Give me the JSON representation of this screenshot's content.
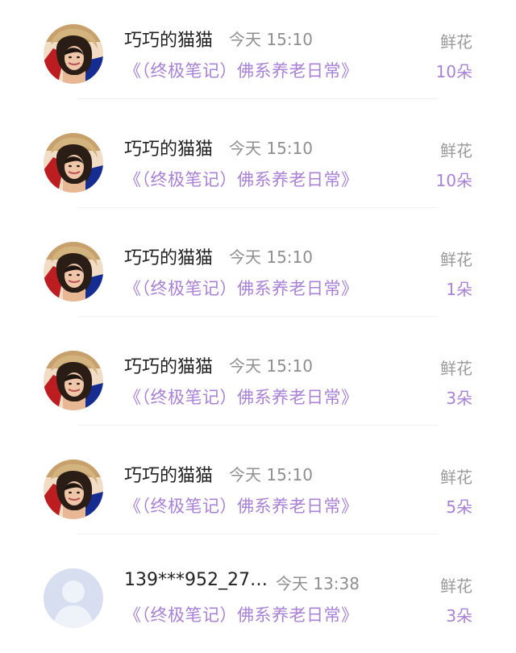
{
  "records": [
    {
      "user": "巧巧的猫猫",
      "time": "今天 15:10",
      "book": "《（终极笔记）佛系养老日常》",
      "gift_label": "鲜花",
      "count": "10朵",
      "avatar": "photo-avatar"
    },
    {
      "user": "巧巧的猫猫",
      "time": "今天 15:10",
      "book": "《（终极笔记）佛系养老日常》",
      "gift_label": "鲜花",
      "count": "10朵",
      "avatar": "photo-avatar"
    },
    {
      "user": "巧巧的猫猫",
      "time": "今天 15:10",
      "book": "《（终极笔记）佛系养老日常》",
      "gift_label": "鲜花",
      "count": "1朵",
      "avatar": "photo-avatar"
    },
    {
      "user": "巧巧的猫猫",
      "time": "今天 15:10",
      "book": "《（终极笔记）佛系养老日常》",
      "gift_label": "鲜花",
      "count": "3朵",
      "avatar": "photo-avatar"
    },
    {
      "user": "巧巧的猫猫",
      "time": "今天 15:10",
      "book": "《（终极笔记）佛系养老日常》",
      "gift_label": "鲜花",
      "count": "5朵",
      "avatar": "photo-avatar"
    },
    {
      "user": "139***952_27…",
      "time": "今天 13:38",
      "book": "《（终极笔记）佛系养老日常》",
      "gift_label": "鲜花",
      "count": "3朵",
      "avatar": "default-avatar-icon"
    }
  ],
  "colors": {
    "accent": "#a981d6",
    "name_text": "#222222",
    "meta_text": "#8f8f8f",
    "divider": "#f0f0f0",
    "default_avatar_bg": "#d7deef"
  }
}
